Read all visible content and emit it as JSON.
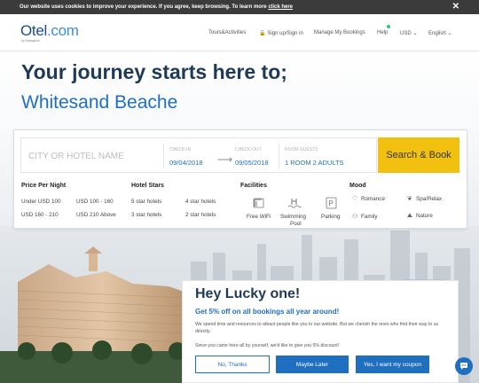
{
  "cookie_bar": {
    "text": "Our website uses cookies to improve your experience. If you agree, keep browsing. To learn more",
    "link": "click here",
    "close_icon": "close-icon"
  },
  "header": {
    "logo_main": "Otel",
    "logo_tld": ".com",
    "logo_sub": "by Metaglobe",
    "nav": {
      "tours": "Tours&Activities",
      "signin": "Sign up/Sign in",
      "bookings": "Manage My Bookings",
      "help": "Help",
      "currency": "USD",
      "language": "English"
    }
  },
  "hero": {
    "title": "Your journey starts here to;",
    "destination": "Whitesand Beache"
  },
  "search": {
    "city_placeholder": "CITY OR HOTEL NAME",
    "checkin_label": "CHECK-IN",
    "checkin_value": "09/04/2018",
    "checkout_label": "CHECK-OUT",
    "checkout_value": "09/05/2018",
    "guests_label": "ROOM GUESTS",
    "guests_value": "1 ROOM 2 ADULTS",
    "button": "Search & Book"
  },
  "filters": {
    "price": {
      "title": "Price Per Night",
      "options": [
        "Under USD 100",
        "USD 100 - 160",
        "USD 160 - 210",
        "USD 210 Above"
      ]
    },
    "stars": {
      "title": "Hotel Stars",
      "options": [
        "5 star hotels",
        "4 star hotels",
        "3 star hotels",
        "2 star hotels"
      ]
    },
    "facilities": {
      "title": "Facilities",
      "items": [
        {
          "label": "Free WiFi",
          "icon": "wifi-icon"
        },
        {
          "label": "Swimming",
          "label2": "Pool",
          "icon": "pool-icon"
        },
        {
          "label": "Parking",
          "icon": "parking-icon"
        }
      ]
    },
    "mood": {
      "title": "Mood",
      "items": [
        {
          "label": "Romance",
          "icon": "heart-icon"
        },
        {
          "label": "Spa/Relax",
          "icon": "spa-icon"
        },
        {
          "label": "Family",
          "icon": "family-icon"
        },
        {
          "label": "Nature",
          "icon": "mountain-icon"
        }
      ]
    }
  },
  "popup": {
    "title": "Hey Lucky one!",
    "offer": "Get 5% off on all bookings all year around!",
    "text1": "We spend time and resources to attract people like you to our website. But we cherish the ones who find their way to us directly.",
    "text2": "Since you came here all by yourself, we'd like to give you 5% discount!",
    "btn_no": "No, Thanks",
    "btn_later": "Maybe Later",
    "btn_yes": "Yes, I want my coupon"
  },
  "colors": {
    "brand_blue": "#1f6fc1",
    "navy": "#1f3a58",
    "cta_yellow": "#f2c10f"
  }
}
